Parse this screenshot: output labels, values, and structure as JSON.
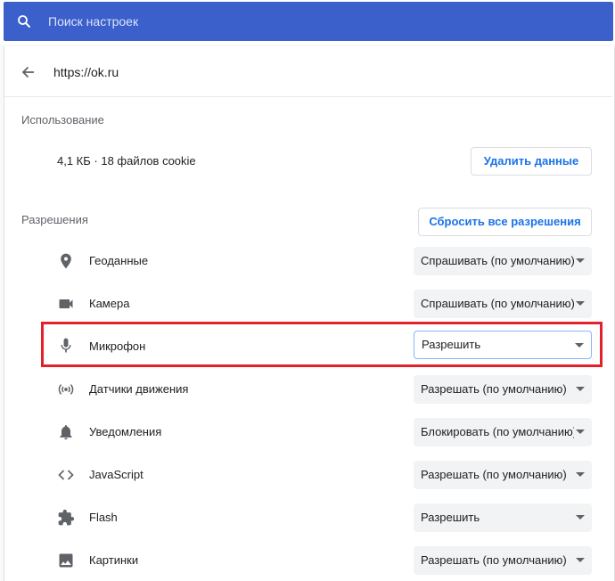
{
  "search": {
    "placeholder": "Поиск настроек"
  },
  "site": {
    "url": "https://ok.ru"
  },
  "usage": {
    "title": "Использование",
    "text": "4,1 КБ · 18 файлов cookie",
    "clear_button": "Удалить данные"
  },
  "permissions": {
    "title": "Разрешения",
    "reset_button": "Сбросить все разрешения",
    "items": [
      {
        "label": "Геоданные",
        "value": "Спрашивать (по умолчанию)",
        "icon": "location-icon"
      },
      {
        "label": "Камера",
        "value": "Спрашивать (по умолчанию)",
        "icon": "camera-icon"
      },
      {
        "label": "Микрофон",
        "value": "Разрешить",
        "icon": "microphone-icon"
      },
      {
        "label": "Датчики движения",
        "value": "Разрешать (по умолчанию)",
        "icon": "motion-sensors-icon"
      },
      {
        "label": "Уведомления",
        "value": "Блокировать (по умолчанию)",
        "icon": "bell-icon"
      },
      {
        "label": "JavaScript",
        "value": "Разрешать (по умолчанию)",
        "icon": "code-icon"
      },
      {
        "label": "Flash",
        "value": "Разрешить",
        "icon": "puzzle-icon"
      },
      {
        "label": "Картинки",
        "value": "Разрешать (по умолчанию)",
        "icon": "image-icon"
      }
    ]
  },
  "colors": {
    "search_bar": "#3b5fcb",
    "accent": "#1a73e8",
    "highlight": "#e2212b"
  }
}
